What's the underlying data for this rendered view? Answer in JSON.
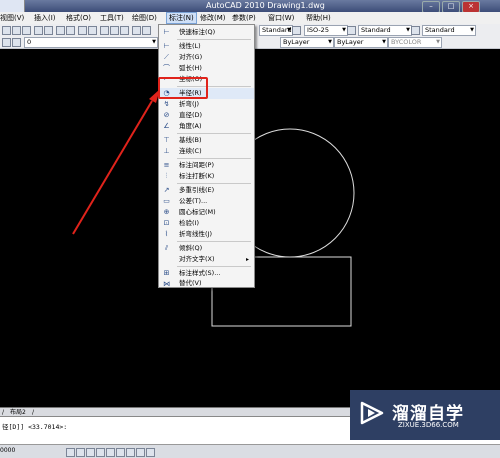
{
  "window": {
    "title": "AutoCAD 2010    Drawing1.dwg"
  },
  "menubar": {
    "items": [
      {
        "label": "视图(V)"
      },
      {
        "label": "插入(I)"
      },
      {
        "label": "格式(O)"
      },
      {
        "label": "工具(T)"
      },
      {
        "label": "绘图(D)"
      },
      {
        "label": "标注(N)"
      },
      {
        "label": "修改(M)"
      },
      {
        "label": "参数(P)"
      },
      {
        "label": "窗口(W)"
      },
      {
        "label": "帮助(H)"
      }
    ]
  },
  "toolbar": {
    "dimstyle": "ISO-25",
    "textstyle": "Standard",
    "tablestyle": "Standard",
    "layer": "0",
    "linetype1": "ByLayer",
    "linetype2": "ByLayer",
    "color": "BYCOLOR"
  },
  "dim_menu": {
    "items": [
      {
        "label": "快速标注(Q)",
        "icon": "quick-dim-icon"
      },
      {
        "label": "线性(L)",
        "icon": "linear-icon"
      },
      {
        "label": "对齐(G)",
        "icon": "aligned-icon"
      },
      {
        "label": "弧长(H)",
        "icon": "arc-length-icon"
      },
      {
        "label": "坐标(O)",
        "icon": "ordinate-icon"
      },
      {
        "label": "半径(R)",
        "icon": "radius-icon"
      },
      {
        "label": "折弯(J)",
        "icon": "jogged-icon"
      },
      {
        "label": "直径(D)",
        "icon": "diameter-icon"
      },
      {
        "label": "角度(A)",
        "icon": "angle-icon"
      },
      {
        "label": "基线(B)",
        "icon": "baseline-icon"
      },
      {
        "label": "连续(C)",
        "icon": "continue-icon"
      },
      {
        "label": "标注间距(P)",
        "icon": "dim-space-icon"
      },
      {
        "label": "标注打断(K)",
        "icon": "dim-break-icon"
      },
      {
        "label": "多重引线(E)",
        "icon": "multileader-icon"
      },
      {
        "label": "公差(T)...",
        "icon": "tolerance-icon"
      },
      {
        "label": "圆心标记(M)",
        "icon": "center-mark-icon"
      },
      {
        "label": "检验(I)",
        "icon": "inspect-icon"
      },
      {
        "label": "折弯线性(J)",
        "icon": "jogged-linear-icon"
      },
      {
        "label": "倾斜(Q)",
        "icon": "oblique-icon"
      },
      {
        "label": "对齐文字(X)",
        "icon": "",
        "submenu": "▸"
      },
      {
        "label": "标注样式(S)...",
        "icon": "dim-style-icon"
      },
      {
        "label": "替代(V)",
        "icon": "override-icon"
      },
      {
        "label": "更新(U)",
        "icon": "update-icon"
      },
      {
        "label": "重新关联标注(N)",
        "icon": "reassociate-icon"
      }
    ]
  },
  "tabs": {
    "layout2": "布局2"
  },
  "command": {
    "line": "径[D]] <33.7014>:"
  },
  "status": {
    "coord": "0000"
  },
  "watermark": {
    "brand": "溜溜自学",
    "url": "ZIXUE.3D66.COM"
  },
  "colors": {
    "highlight": "#e0231b",
    "arrow": "#e0231b",
    "brand_bg": "#2e3f63"
  }
}
